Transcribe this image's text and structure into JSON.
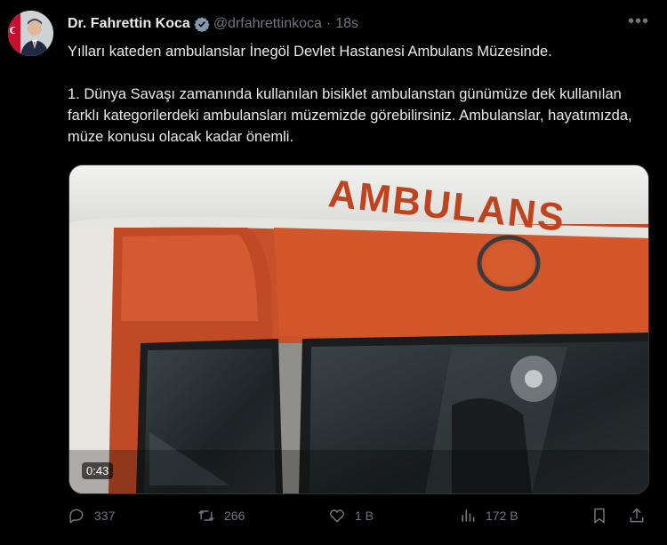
{
  "author": {
    "name": "Dr. Fahrettin Koca",
    "handle": "@drfahrettinkoca",
    "separator": "·",
    "time": "18s"
  },
  "tweet": {
    "text": "Yılları kateden ambulanslar İnegöl Devlet Hastanesi Ambulans Müzesinde.\n\n1. Dünya Savaşı zamanında kullanılan bisiklet ambulanstan günümüze dek kullanılan farklı kategorilerdeki ambulansları müzemizde görebilirsiniz. Ambulanslar, hayatımızda, müze konusu olacak kadar önemli."
  },
  "media": {
    "vehicle_text": "AMBULANS",
    "duration": "0:43"
  },
  "actions": {
    "replies": "337",
    "retweets": "266",
    "likes": "1 B",
    "views": "172 B"
  },
  "colors": {
    "accent": "#1d9bf0",
    "muted": "#71767b",
    "ambulance_orange": "#d2552a"
  }
}
